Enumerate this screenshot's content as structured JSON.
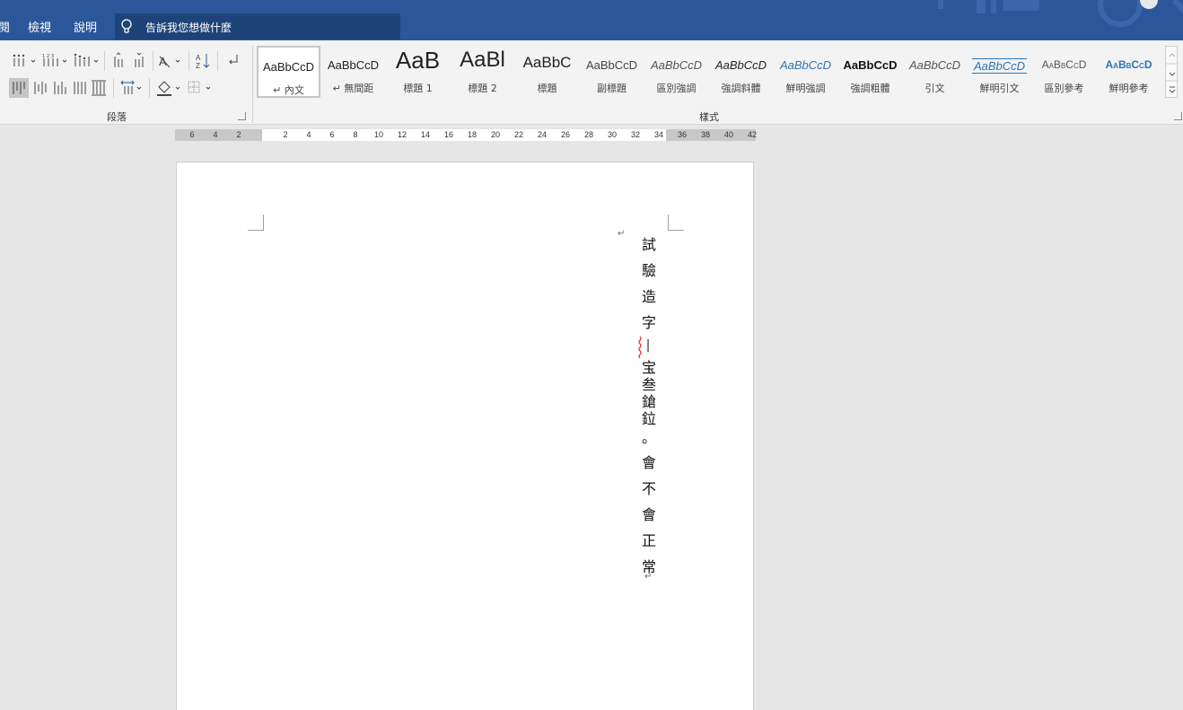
{
  "tabs": {
    "left_fragment": "閱",
    "view": "檢視",
    "help": "說明"
  },
  "tell_me": {
    "placeholder": "告訴我您想做什麼"
  },
  "ribbon": {
    "paragraph_group": "段落",
    "styles_group": "樣式",
    "styles": [
      {
        "sample": "AaBbCcD",
        "name": "↵ 內文",
        "selected": true
      },
      {
        "sample": "AaBbCcD",
        "name": "↵ 無間距"
      },
      {
        "sample": "AaB",
        "name": "標題 1"
      },
      {
        "sample": "AaBl",
        "name": "標題 2"
      },
      {
        "sample": "AaBbC",
        "name": "標題"
      },
      {
        "sample": "AaBbCcD",
        "name": "副標題"
      },
      {
        "sample": "AaBbCcD",
        "name": "區別強調"
      },
      {
        "sample": "AaBbCcD",
        "name": "強調斜體"
      },
      {
        "sample": "AaBbCcD",
        "name": "鮮明強調"
      },
      {
        "sample": "AaBbCcD",
        "name": "強調粗體"
      },
      {
        "sample": "AaBbCcD",
        "name": "引文"
      },
      {
        "sample": "AaBbCcD",
        "name": "鮮明引文"
      },
      {
        "sample": "AaBbCcD",
        "name": "區別參考"
      },
      {
        "sample": "AaBbCcD",
        "name": "鮮明參考"
      }
    ]
  },
  "ruler": {
    "left_numbers": [
      "6",
      "4",
      "2"
    ],
    "numbers": [
      "2",
      "4",
      "6",
      "8",
      "10",
      "12",
      "14",
      "16",
      "18",
      "20",
      "22",
      "24",
      "26",
      "28",
      "30",
      "32",
      "34",
      "36",
      "38",
      "40",
      "42"
    ]
  },
  "document": {
    "chars_top": [
      "試",
      "驗",
      "造",
      "字"
    ],
    "dash": "—",
    "chars_tight": [
      "宝",
      "叁",
      "鎗",
      "鉝"
    ],
    "period": "。",
    "chars_bottom": [
      "會",
      "不",
      "會",
      "正",
      "常"
    ],
    "para_mark": "↵"
  },
  "colors": {
    "accent": "#2b579a",
    "tellme_bg": "#1e4379",
    "blue_style": "#2e74b5"
  }
}
